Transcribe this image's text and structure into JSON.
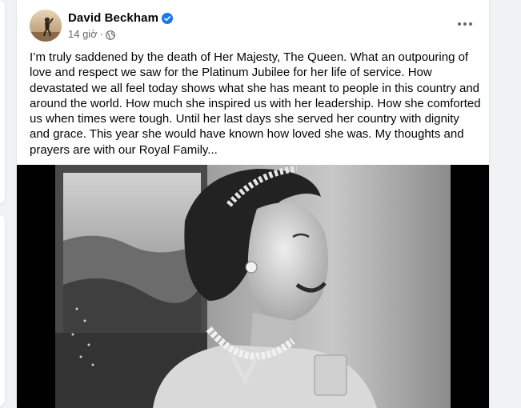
{
  "post": {
    "author": "David Beckham",
    "time": "14 giờ",
    "separator": "·",
    "text": "I’m truly saddened by the death of Her Majesty, The Queen. What an outpouring of love and respect we saw for the Platinum Jubilee for her life of service. How devastated we all feel today shows what she has meant to people in this country and around the world. How much she inspired us with her leadership. How she comforted us when times were tough. Until her last days she served her country with dignity and grace. This year she would have known how loved she was. My thoughts and prayers are with our Royal Family...",
    "verified_color": "#1877f2",
    "icons": {
      "verified": "verified-badge-icon",
      "privacy": "globe-icon",
      "more": "more-options-icon"
    }
  }
}
